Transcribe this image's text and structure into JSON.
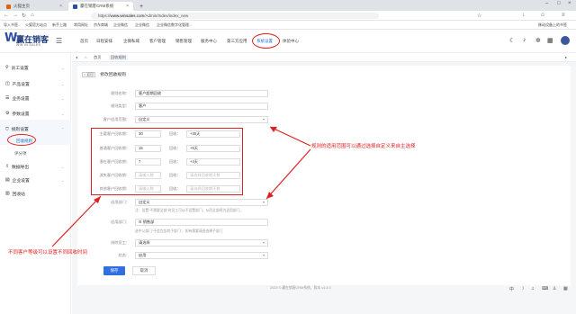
{
  "browser": {
    "tabs": [
      {
        "title": "火狐主页",
        "color": "#e66000"
      },
      {
        "title": "赢在销客CRM系统",
        "color": "#2b4fa0"
      }
    ],
    "new_tab": "+",
    "url_prefix": "https://",
    "url_host": "www.winsales.com",
    "url_path": "/Admin/Index/index_new",
    "bookmarks": [
      "导入书签...",
      "火狐官方站点",
      "新手上路",
      "常用网址",
      "京东商城",
      "企业微信",
      "企业微信",
      "企业微信数字化管理...",
      "移动设备上的书签"
    ]
  },
  "app": {
    "logo_mark": "W",
    "name": "赢在销客",
    "slogan": "WIN IN SALES",
    "top_nav": [
      "首页",
      "日程安排",
      "企微私域",
      "客户管理",
      "销售管理",
      "服务中心",
      "第三方应用",
      "系统设置",
      "体验中心"
    ],
    "active_nav": "系统设置"
  },
  "sidebar": {
    "items": [
      {
        "label": "员工设置",
        "icon": "person-icon"
      },
      {
        "label": "产品设置",
        "icon": "box-icon"
      },
      {
        "label": "业务设置",
        "icon": "list-icon"
      },
      {
        "label": "参数设置",
        "icon": "gear-icon"
      },
      {
        "label": "规则设置",
        "icon": "shield-icon"
      },
      {
        "label": "数据导出",
        "icon": "export-icon"
      },
      {
        "label": "企业设置",
        "icon": "building-icon"
      },
      {
        "label": "回收站",
        "icon": "trash-icon"
      }
    ],
    "sub_items": [
      "回收规则",
      "评分项"
    ],
    "active_sub": "回收规则"
  },
  "breadcrumb": {
    "items": [
      "首页",
      "回收规则"
    ]
  },
  "form": {
    "back_label": "< 返回",
    "title": "修改回收规则",
    "fields": {
      "rule_name": {
        "label": "规则名称：",
        "value": "客户超期回收"
      },
      "rule_type": {
        "label": "规则类型：",
        "value": "客户"
      },
      "customer_level": {
        "label": "客户适用范围：",
        "value": "自定义"
      },
      "days_rows": [
        {
          "label": "主要客户回收期：",
          "value": "30",
          "unit": "回收：",
          "tag": "+30天"
        },
        {
          "label": "普通客户回收期：",
          "value": "15",
          "unit": "回收：",
          "tag": "+6天"
        },
        {
          "label": "潜在客户回收期：",
          "value": "7",
          "unit": "回收：",
          "tag": "+4天"
        },
        {
          "label": "流失客户回收期：",
          "value": "",
          "placeholder": "请输入数",
          "unit": "回收：",
          "tag": "",
          "tag_placeholder": "请选择回收期天数"
        },
        {
          "label": "其他客户回收期：",
          "value": "",
          "placeholder": "请输入数",
          "unit": "回收：",
          "tag": "",
          "tag_placeholder": "请选择回收期天数"
        }
      ],
      "applies_to": {
        "label": "适用部门：",
        "value": "自定义"
      },
      "applies_hint": "注：设置“不需要全部”时员工可以不设置部门，从而全部视为适用部门。",
      "department": {
        "label": "适用部门：",
        "value": "销售部"
      },
      "department_hint": "选中父部门“不会包含其子部门”，如有需要请逐选择子部门",
      "exclude_staff": {
        "label": "排除员工：",
        "value": "请选择"
      },
      "status": {
        "label": "状态：",
        "value": "启用"
      }
    },
    "save_label": "保存",
    "cancel_label": "取消"
  },
  "annotations": {
    "right": "规则的适用范围可以通过选择自定义来自主选择",
    "left": "不同客户等级可以设置不同回收时间"
  },
  "footer": "2023 © 赢在销客CRM系统，版本 v4.3.0",
  "colors": {
    "accent": "#2f6fe0",
    "annotation": "#e02020",
    "logo": "#2b4fa0"
  }
}
